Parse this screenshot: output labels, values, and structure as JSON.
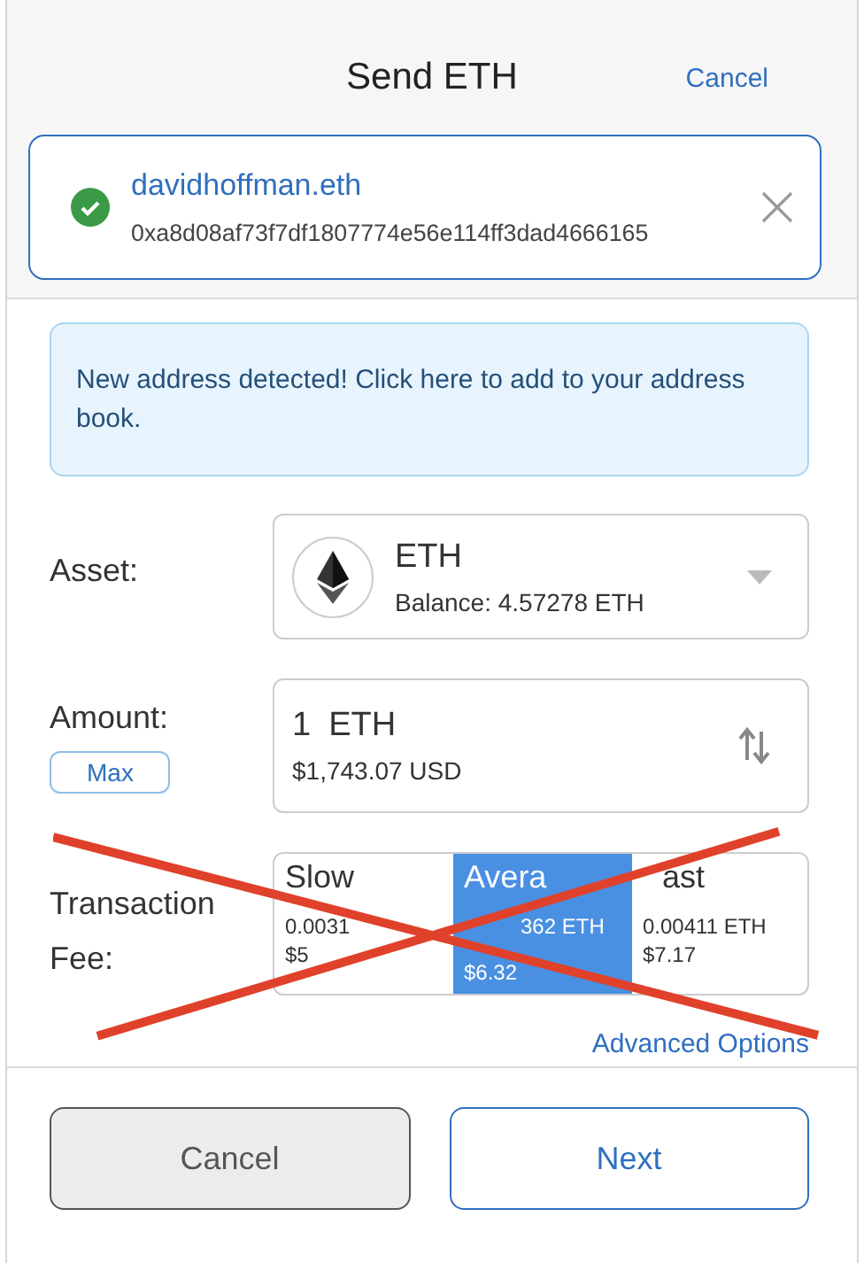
{
  "header": {
    "title": "Send ETH",
    "cancel": "Cancel"
  },
  "recipient": {
    "verified": true,
    "name": "davidhoffman.eth",
    "address": "0xa8d08af73f7df1807774e56e114ff3dad4666165"
  },
  "notice": {
    "text": "New address detected! Click here to add to your address book."
  },
  "asset": {
    "label": "Asset:",
    "symbol": "ETH",
    "balance": "Balance: 4.57278 ETH"
  },
  "amount": {
    "label": "Amount:",
    "max": "Max",
    "value": "1",
    "unit": "ETH",
    "fiat": "$1,743.07 USD"
  },
  "fee": {
    "label": "Transaction Fee:",
    "options": [
      {
        "name": "Slow",
        "eth": "0.0031",
        "usd": "$5",
        "selected": false
      },
      {
        "name": "Avera",
        "eth": "362 ETH",
        "usd": "$6.32",
        "selected": true
      },
      {
        "name": "ast",
        "eth": "0.00411 ETH",
        "usd": "$7.17",
        "selected": false
      }
    ]
  },
  "advanced": "Advanced Options",
  "footer": {
    "buttons": [
      {
        "label": "Cancel",
        "kind": "secondary"
      },
      {
        "label": "Next",
        "kind": "primary"
      }
    ]
  }
}
